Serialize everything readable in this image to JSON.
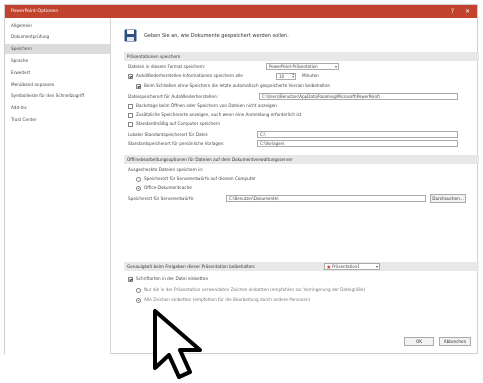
{
  "window": {
    "title": "PowerPoint-Optionen",
    "titlebar_color": "#c1432e",
    "help_label": "?",
    "close_label": "✕"
  },
  "sidebar": {
    "items": [
      {
        "label": "Allgemein"
      },
      {
        "label": "Dokumentprüfung"
      },
      {
        "label": "Speichern",
        "active": true
      },
      {
        "label": "Sprache"
      },
      {
        "label": "Erweitert"
      },
      {
        "label": "Menüband anpassen"
      },
      {
        "label": "Symbolleiste für den Schnellzugriff"
      },
      {
        "label": "Add-Ins"
      },
      {
        "label": "Trust Center"
      }
    ]
  },
  "header": {
    "text": "Geben Sie an, wie Dokumente gespeichert werden sollen."
  },
  "save_section": {
    "title": "Präsentationen speichern",
    "format_label": "Dateien in diesem Format speichern:",
    "format_value": "PowerPoint-Präsentation",
    "autorecover_label": "AutoWiederherstellen-Informationen speichern alle",
    "autorecover_minutes": "10",
    "minutes_label": "Minuten",
    "keep_last_label": "Beim Schließen ohne Speichern die letzte automatisch gespeicherte Version beibehalten",
    "autorecover_location_label": "Dateispeicherort für AutoWiederherstellen:",
    "autorecover_location_value": "C:\\Users\\Benutzer\\AppData\\Roaming\\Microsoft\\PowerPoint\\",
    "backstage_label": "Backstage beim Öffnen oder Speichern von Dateien nicht anzeigen",
    "additional_places_label": "Zusätzliche Speicherorte anzeigen, auch wenn eine Anmeldung erforderlich ist",
    "default_local_label": "Standardmäßig auf Computer speichern",
    "local_location_label": "Lokaler Standardspeicherort für Datei:",
    "local_location_value": "C:\\",
    "personal_templates_label": "Standardspeicherort für persönliche Vorlagen:",
    "personal_templates_value": "C:\\Vorlagen\\"
  },
  "offline_section": {
    "title": "Offlinebearbeitungsoptionen für Dateien auf dem Dokumentverwaltungsserver",
    "save_checked_out_label": "Ausgecheckte Dateien speichern in:",
    "option_server_label": "Speicherort für Serverentwürfe auf diesem Computer",
    "option_cache_label": "Office-Dokumentcache",
    "drafts_location_label": "Speicherort für Serverentwürfe:",
    "drafts_location_value": "C:\\Benutzer\\Dokumente\\",
    "browse_label": "Durchsuchen..."
  },
  "fidelity_section": {
    "title": "Genauigkeit beim Freigeben dieser Präsentation beibehalten:",
    "presentation_value": "Präsentation1",
    "embed_fonts_label": "Schriftarten in der Datei einbetten",
    "option_used_chars_label": "Nur die in der Präsentation verwendeten Zeichen einbetten (empfohlen zur Verringerung der Dateigröße)",
    "option_all_chars_label": "Alle Zeichen einbetten (empfohlen für die Bearbeitung durch andere Personen)"
  },
  "footer": {
    "ok_label": "OK",
    "cancel_label": "Abbrechen"
  },
  "colors": {
    "accent": "#c1432e",
    "section_bg": "#e8e8e8",
    "active_nav_bg": "#dcdcdc"
  },
  "icons": {
    "header": "save-disk-icon",
    "cursor": "mouse-pointer-icon"
  }
}
